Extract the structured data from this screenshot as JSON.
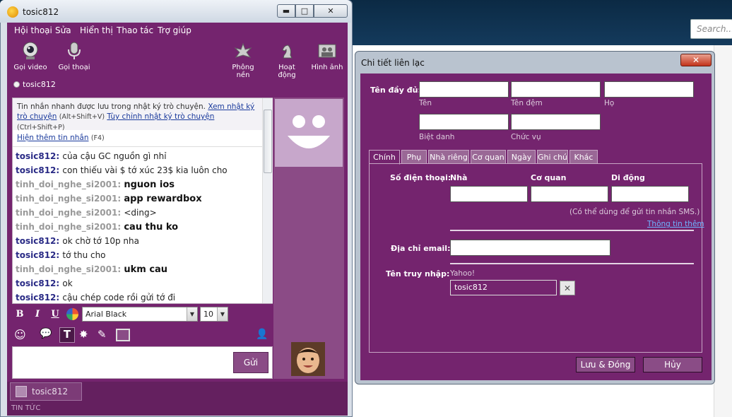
{
  "background": {
    "search_placeholder": "Search..."
  },
  "messenger": {
    "title": "tosic812",
    "window_buttons": {
      "minimize": "▬",
      "maximize": "□",
      "close": "✕"
    },
    "menu": [
      "Hội thoại",
      "Sửa",
      "Hiển thị",
      "Thao tác",
      "Trợ giúp"
    ],
    "toolbar": {
      "video": "Gọi video",
      "voice": "Gọi thoại",
      "wallpaper": "Phông nền",
      "activity": "Hoạt động",
      "photos": "Hình ảnh"
    },
    "contact_status": "tosic812",
    "info": {
      "text1": "Tin nhắn nhanh được lưu trong nhật ký trò chuyện.",
      "link1": "Xem nhật ký trò chuyện",
      "shortcut1": "(Alt+Shift+V)",
      "link2": "Tùy chỉnh nhật ký trò chuyện",
      "shortcut2": "(Ctrl+Shift+P)"
    },
    "show_more": {
      "link": "Hiện thêm tin nhắn",
      "shortcut": "(F4)"
    },
    "messages": [
      {
        "sender": "tosic812",
        "text": "của cậu GC nguồn gì nhỉ"
      },
      {
        "sender": "tosic812",
        "text": "con thiếu vài $ tớ xúc 23$ kia luôn cho"
      },
      {
        "sender": "tinh_doi_nghe_si2001",
        "text": "nguon ios"
      },
      {
        "sender": "tinh_doi_nghe_si2001",
        "text": "app rewardbox"
      },
      {
        "sender": "tinh_doi_nghe_si2001",
        "text": "<ding>"
      },
      {
        "sender": "tinh_doi_nghe_si2001",
        "text": "cau thu ko"
      },
      {
        "sender": "tosic812",
        "text": "ok chờ tớ 10p nha"
      },
      {
        "sender": "tosic812",
        "text": "tớ thu cho"
      },
      {
        "sender": "tinh_doi_nghe_si2001",
        "text": "ukm cau"
      },
      {
        "sender": "tosic812",
        "text": "ok"
      },
      {
        "sender": "tosic812",
        "text": "cậu chép code rồi gửi tớ đi"
      }
    ],
    "format": {
      "bold": "B",
      "italic": "I",
      "underline": "U",
      "font": "Arial Black",
      "size": "10"
    },
    "send": "Gửi",
    "conversation_tab": "tosic812",
    "news": "TIN TỨC"
  },
  "dialog": {
    "title": "Chi tiết liên lạc",
    "close": "✕",
    "full_name_label": "Tên đầy đủ:",
    "name_fields": {
      "first": "Tên",
      "middle": "Tên đệm",
      "last": "Họ",
      "nickname": "Biệt danh",
      "job_title": "Chức vụ"
    },
    "tabs": [
      "Chính",
      "Phụ",
      "Nhà riêng",
      "Cơ quan",
      "Ngày",
      "Ghi chú",
      "Khác"
    ],
    "phone_label": "Số điện thoại:",
    "phone_types": {
      "home": "Nhà",
      "work": "Cơ quan",
      "mobile": "Di động"
    },
    "sms_note": "(Có thể dùng để gửi tin nhắn SMS.)",
    "more_info": "Thông tin thêm",
    "email_label": "Địa chỉ email:",
    "username_label": "Tên truy nhập:",
    "service": "Yahoo!",
    "username_value": "tosic812",
    "clear": "✕",
    "save_button": "Lưu & Đóng",
    "cancel_button": "Hủy"
  }
}
